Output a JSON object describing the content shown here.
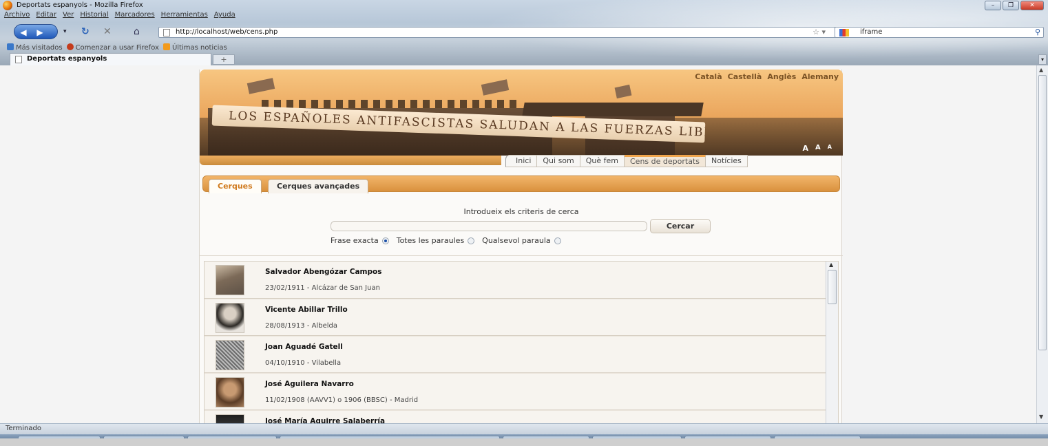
{
  "window": {
    "title": "Deportats espanyols - Mozilla Firefox",
    "buttons": [
      "–",
      "❐",
      "✕"
    ]
  },
  "menubar": [
    "Archivo",
    "Editar",
    "Ver",
    "Historial",
    "Marcadores",
    "Herramientas",
    "Ayuda"
  ],
  "navbar": {
    "url": "http://localhost/web/cens.php",
    "search_value": "iframe"
  },
  "bookmarks": [
    {
      "label": "Más visitados",
      "icon": "most-visited-icon",
      "color": "#3a78c9"
    },
    {
      "label": "Comenzar a usar Firefox",
      "icon": "firefox-getting-started-icon",
      "color": "#c43b1c"
    },
    {
      "label": "Últimas noticias",
      "icon": "rss-feed-icon",
      "color": "#f29a1c"
    }
  ],
  "tab": {
    "title": "Deportats espanyols",
    "new_tab": "+"
  },
  "page": {
    "languages": [
      "Català",
      "Castellà",
      "Anglès",
      "Alemany"
    ],
    "font_sizes": [
      "A",
      "A",
      "A"
    ],
    "banner_text": "LOS ESPAÑOLES ANTIFASCISTAS SALUDAN A LAS FUERZAS LIBER",
    "nav": [
      "Inici",
      "Qui som",
      "Què fem",
      "Cens de deportats",
      "Notícies"
    ],
    "nav_active": "Cens de deportats",
    "search": {
      "tabs": [
        "Cerques",
        "Cerques avançades"
      ],
      "prompt": "Introdueix els criteris de cerca",
      "input_value": "",
      "button": "Cercar",
      "options": [
        "Frase exacta",
        "Totes les paraules",
        "Qualsevol paraula"
      ],
      "selected_option": "Frase exacta"
    },
    "results": [
      {
        "name": "Salvador Abengózar Campos",
        "info": "23/02/1911 - Alcázar de San Juan"
      },
      {
        "name": "Vicente Abillar Trillo",
        "info": "28/08/1913 - Albelda"
      },
      {
        "name": "Joan Aguadé Gatell",
        "info": "04/10/1910 - Vilabella"
      },
      {
        "name": "José Aguilera Navarro",
        "info": "11/02/1908 (AAVV1) o 1906 (BBSC) - Madrid"
      },
      {
        "name": "José María Aguirre Salaberría",
        "info": ""
      }
    ]
  },
  "statusbar": {
    "text": "Terminado"
  },
  "colors": {
    "accent": "#f0a54c",
    "brand_brown": "#7a5224",
    "firefox_blue": "#1e57b8"
  }
}
